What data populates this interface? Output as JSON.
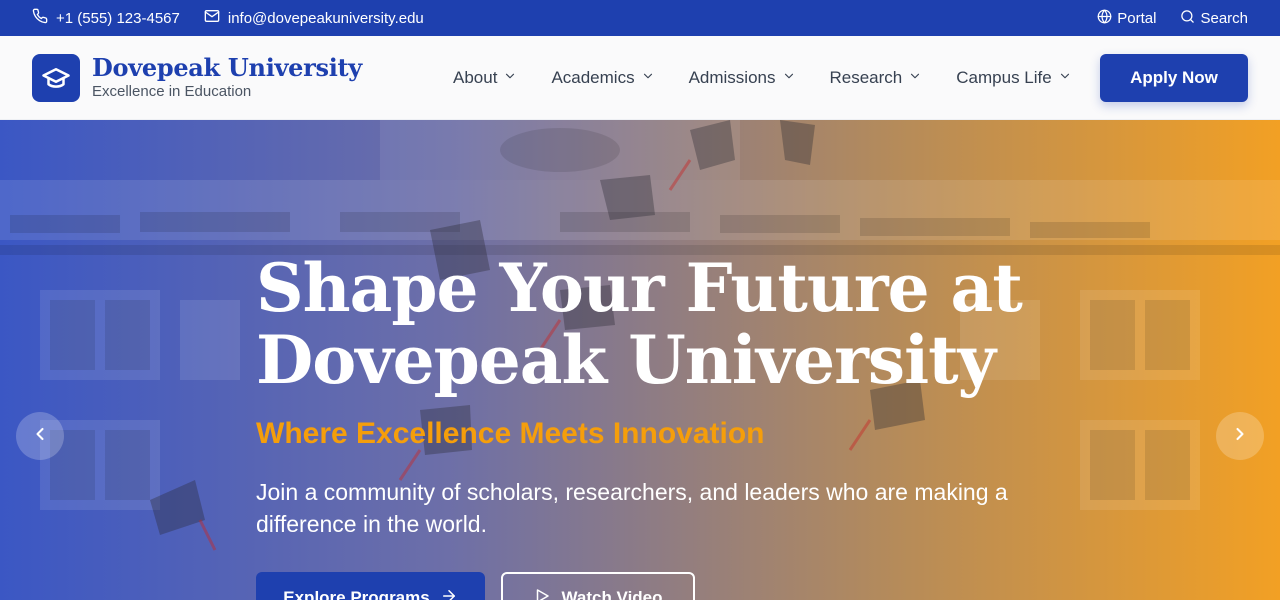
{
  "topbar": {
    "phone": "+1 (555) 123-4567",
    "email": "info@dovepeakuniversity.edu",
    "portal_label": "Portal",
    "search_label": "Search"
  },
  "header": {
    "university_name": "Dovepeak University",
    "tagline": "Excellence in Education",
    "nav": [
      {
        "label": "About"
      },
      {
        "label": "Academics"
      },
      {
        "label": "Admissions"
      },
      {
        "label": "Research"
      },
      {
        "label": "Campus Life"
      }
    ],
    "apply_label": "Apply Now"
  },
  "hero": {
    "title_line1": "Shape Your Future at",
    "title_line2": "Dovepeak University",
    "subtitle": "Where Excellence Meets Innovation",
    "description": "Join a community of scholars, researchers, and leaders who are making a difference in the world.",
    "primary_label": "Explore Programs",
    "secondary_label": "Watch Video"
  },
  "colors": {
    "brand": "#1e40af",
    "accent": "#f59e0b",
    "gradient_start": "#3b57c4",
    "gradient_end": "#f2a024"
  },
  "icons": {
    "phone": "phone-icon",
    "email": "mail-icon",
    "portal": "globe-icon",
    "search": "search-icon",
    "logo": "graduation-cap-icon",
    "dropdown": "chevron-down-icon",
    "explore": "arrow-right-icon",
    "video": "play-icon",
    "prev": "chevron-left-icon",
    "next": "chevron-right-icon"
  }
}
